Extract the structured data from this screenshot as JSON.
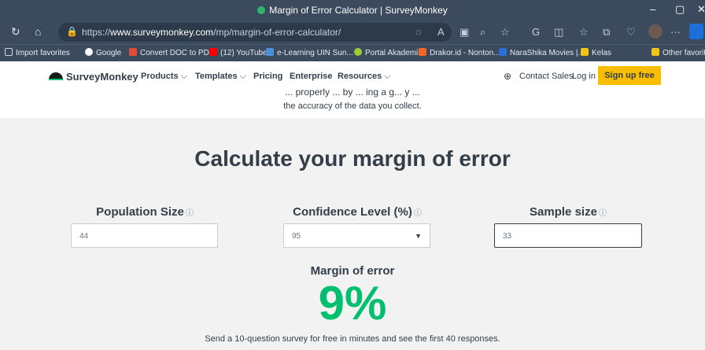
{
  "browser": {
    "title": "Margin of Error Calculator | SurveyMonkey",
    "url_prefix": "https://",
    "url_domain": "www.surveymonkey.com",
    "url_path": "/mp/margin-of-error-calculator/",
    "bookmarks": [
      {
        "label": "Import favorites",
        "color": "#cfd8e2"
      },
      {
        "label": "Google",
        "color": "#ffffff"
      },
      {
        "label": "Convert DOC to PD...",
        "color": "#e04b3a"
      },
      {
        "label": "(12) YouTube",
        "color": "#ff0000"
      },
      {
        "label": "e-Learning UIN Sun...",
        "color": "#4a90d9"
      },
      {
        "label": "Portal Akademik",
        "color": "#9acd32"
      },
      {
        "label": "Drakor.id - Nonton...",
        "color": "#f26522"
      },
      {
        "label": "NaraShika Movies |...",
        "color": "#2a6fd6"
      },
      {
        "label": "Kelas",
        "color": "#f0c419"
      },
      {
        "label": "Other favorites",
        "color": "#f0c419"
      }
    ]
  },
  "site": {
    "brand": "SurveyMonkey",
    "nav": [
      {
        "label": "Products",
        "dropdown": true
      },
      {
        "label": "Templates",
        "dropdown": true
      },
      {
        "label": "Pricing",
        "dropdown": false
      },
      {
        "label": "Enterprise",
        "dropdown": false
      },
      {
        "label": "Resources",
        "dropdown": true
      }
    ],
    "contact_sales": "Contact Sales",
    "login": "Log in",
    "signup": "Sign up free"
  },
  "intro": {
    "cut_line": "... properly ... by ... ing a g... y ...",
    "line": "the accuracy of the data you collect."
  },
  "calculator": {
    "heading": "Calculate your margin of error",
    "population_label": "Population Size",
    "population_value": "44",
    "confidence_label": "Confidence Level (%)",
    "confidence_value": "95",
    "sample_label": "Sample size",
    "sample_value": "33",
    "result_label": "Margin of error",
    "result_value": "9%",
    "cta": "Send a 10-question survey for free in minutes and see the first 40 responses."
  },
  "colors": {
    "accent_green": "#00bf6f",
    "signup_yellow": "#f9be00",
    "text_dark": "#333e48"
  }
}
